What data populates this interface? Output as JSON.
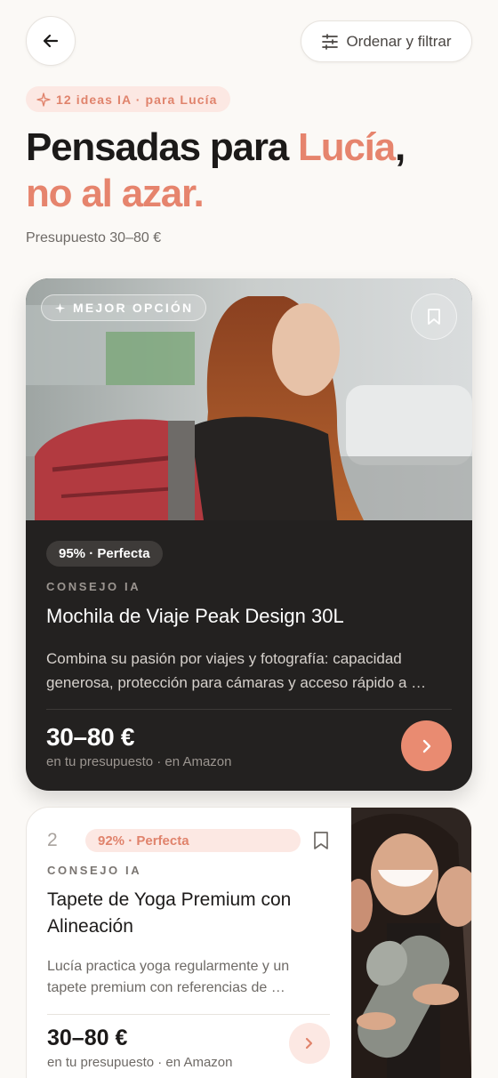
{
  "topbar": {
    "sort_filter_label": "Ordenar y filtrar"
  },
  "hero": {
    "ai_chip": "12 ideas IA · para Lucía",
    "headline_part1": "Pensadas para ",
    "headline_name": "Lucía",
    "headline_comma": ",",
    "headline_part2": "no al azar.",
    "budget": "Presupuesto 30–80 €"
  },
  "cards": [
    {
      "badge": "MEJOR OPCIÓN",
      "match": "95% · Perfecta",
      "tip_label": "CONSEJO IA",
      "title": "Mochila de Viaje Peak Design 30L",
      "description": "Combina su pasión por viajes y fotografía: capacidad generosa, protección para cámaras y acceso rápido a …",
      "price": "30–80 €",
      "store": "en tu presupuesto · en Amazon"
    },
    {
      "rank": "2",
      "match": "92% · Perfecta",
      "tip_label": "CONSEJO IA",
      "title": "Tapete de Yoga Premium con Alineación",
      "description": "Lucía practica yoga regularmente y un tapete premium con referencias de …",
      "price": "30–80 €",
      "store": "en tu presupuesto · en Amazon"
    }
  ],
  "colors": {
    "accent": "#E6846D",
    "accent_soft": "#FCE8E3",
    "dark_card": "#232120",
    "background": "#FBF9F6"
  },
  "icons": {
    "back": "arrow-left-icon",
    "sort": "sliders-icon",
    "sparkle": "sparkle-icon",
    "bookmark": "bookmark-icon",
    "go": "chevron-right-icon"
  }
}
